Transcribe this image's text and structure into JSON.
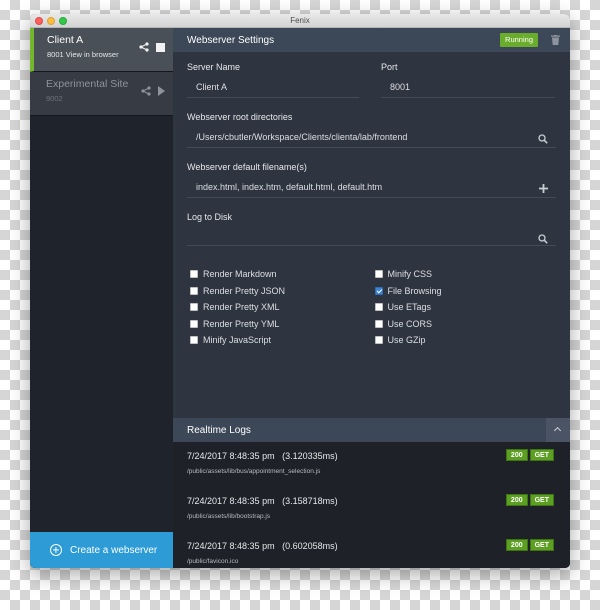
{
  "window": {
    "title": "Fenix"
  },
  "sidebar": {
    "sites": [
      {
        "name": "Client A",
        "port": "8001",
        "link": "View in browser"
      },
      {
        "name": "Experimental Site",
        "port": "9002"
      }
    ],
    "create_label": "Create a webserver"
  },
  "settings": {
    "title": "Webserver Settings",
    "status": "Running",
    "server_name_label": "Server Name",
    "server_name": "Client A",
    "port_label": "Port",
    "port": "8001",
    "root_label": "Webserver root directories",
    "root": "/Users/cbutler/Workspace/Clients/clienta/lab/frontend",
    "default_label": "Webserver default filename(s)",
    "default": "index.html, index.htm, default.html, default.htm",
    "log_label": "Log to Disk",
    "log_value": "",
    "options_left": [
      {
        "label": "Render Markdown",
        "checked": false
      },
      {
        "label": "Render Pretty JSON",
        "checked": false
      },
      {
        "label": "Render Pretty XML",
        "checked": false
      },
      {
        "label": "Render Pretty YML",
        "checked": false
      },
      {
        "label": "Minify JavaScript",
        "checked": false
      }
    ],
    "options_right": [
      {
        "label": "Minify CSS",
        "checked": false
      },
      {
        "label": "File Browsing",
        "checked": true
      },
      {
        "label": "Use ETags",
        "checked": false
      },
      {
        "label": "Use CORS",
        "checked": false
      },
      {
        "label": "Use GZip",
        "checked": false
      }
    ]
  },
  "logs": {
    "title": "Realtime Logs",
    "entries": [
      {
        "time": "7/24/2017 8:48:35 pm",
        "duration": "(3.120335ms)",
        "path": "/public/assets/lib/bus/appointment_selection.js",
        "status": "200",
        "method": "GET"
      },
      {
        "time": "7/24/2017 8:48:35 pm",
        "duration": "(3.158718ms)",
        "path": "/public/assets/lib/bootstrap.js",
        "status": "200",
        "method": "GET"
      },
      {
        "time": "7/24/2017 8:48:35 pm",
        "duration": "(0.602058ms)",
        "path": "/public/favicon.ico",
        "status": "200",
        "method": "GET"
      }
    ]
  },
  "colors": {
    "accent": "#2c9bd6",
    "running": "#6aad2c",
    "active_marker": "#74b72e"
  },
  "icons": [
    "share-icon",
    "stop-icon",
    "play-icon",
    "trash-icon",
    "search-icon",
    "plus-icon",
    "chevron-up-icon",
    "plus-circle-icon"
  ]
}
